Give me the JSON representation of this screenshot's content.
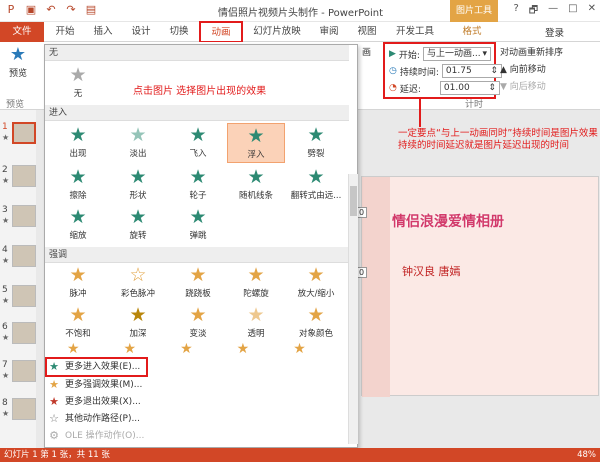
{
  "titlebar": {
    "title": "情侣照片视频片头制作 - PowerPoint",
    "picture_tools": "图片工具",
    "window_controls": [
      "?",
      "🗗",
      "—",
      "□",
      "✕"
    ]
  },
  "tabs": [
    {
      "label": "文件"
    },
    {
      "label": "开始"
    },
    {
      "label": "插入"
    },
    {
      "label": "设计"
    },
    {
      "label": "切换"
    },
    {
      "label": "动画"
    },
    {
      "label": "幻灯片放映"
    },
    {
      "label": "审阅"
    },
    {
      "label": "视图"
    },
    {
      "label": "开发工具"
    },
    {
      "label": "格式"
    }
  ],
  "login": "登录",
  "ribbon": {
    "preview_label": "预览",
    "preview_group": "预览",
    "group_label_fragment": "画",
    "timing": {
      "start_label": "开始:",
      "start_value": "与上一动画...",
      "duration_label": "持续时间:",
      "duration_value": "01.75",
      "delay_label": "延迟:",
      "delay_value": "01.00",
      "group_label": "计时"
    },
    "reorder": {
      "title": "对动画重新排序",
      "forward": "向前移动",
      "backward": "向后移动"
    }
  },
  "menu": {
    "none_section": "无",
    "none_item": "无",
    "entrance_section": "进入",
    "entrance": [
      "出现",
      "淡出",
      "飞入",
      "浮入",
      "劈裂",
      "擦除",
      "形状",
      "轮子",
      "随机线条",
      "翻转式由远...",
      "缩放",
      "旋转",
      "弹跳"
    ],
    "emphasis_section": "强调",
    "emphasis": [
      "脉冲",
      "彩色脉冲",
      "跷跷板",
      "陀螺旋",
      "放大/缩小",
      "不饱和",
      "加深",
      "变淡",
      "透明",
      "对象颜色"
    ],
    "more": [
      "更多进入效果(E)...",
      "更多强调效果(M)...",
      "更多退出效果(X)...",
      "其他动作路径(P)...",
      "OLE 操作动作(O)..."
    ]
  },
  "annotations": {
    "menu_note": "点击图片 选择图片出现的效果",
    "timing_note": "一定要点“与上一动画同时”持续时间是图片效果持续的时间延迟就是图片延迟出现的时间"
  },
  "slides": [
    {
      "num": "1"
    },
    {
      "num": "2"
    },
    {
      "num": "3"
    },
    {
      "num": "4"
    },
    {
      "num": "5"
    },
    {
      "num": "6"
    },
    {
      "num": "7"
    },
    {
      "num": "8"
    }
  ],
  "slide": {
    "title": "情侣浪漫爱情相册",
    "authors": "钟汉良  唐嫣",
    "tags": [
      "0",
      "0"
    ]
  },
  "status": {
    "left": "幻灯片 1 第 1 张，共 11 张",
    "zoom": "48%"
  },
  "colors": {
    "accent": "#d24726",
    "annotation": "#e21b1b",
    "entrance_star": "#2d8a73",
    "emphasis_star": "#e3a445"
  }
}
